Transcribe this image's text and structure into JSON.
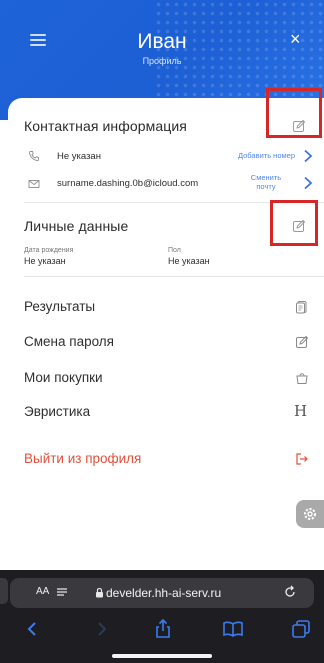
{
  "header": {
    "title": "Иван",
    "subtitle": "Профиль",
    "close_label": "×"
  },
  "contact": {
    "title": "Контактная информация",
    "phone_value": "Не указан",
    "phone_action": "Добавить номер",
    "email_value": "surname.dashing.0b@icloud.com",
    "email_action_line1": "Сменить",
    "email_action_line2": "почту"
  },
  "personal": {
    "title": "Личные данные",
    "birth_label": "Дата рождения",
    "birth_value": "Не указан",
    "gender_label": "Пол",
    "gender_value": "Не указан"
  },
  "menu": {
    "results": "Результаты",
    "change_password": "Смена пароля",
    "purchases": "Мои покупки",
    "heuristics": "Эвристика",
    "heuristics_icon_glyph": "H",
    "logout": "Выйти из профиля"
  },
  "browser": {
    "text_size": "AA",
    "url": "develder.hh-ai-serv.ru"
  },
  "colors": {
    "brand_blue": "#1e63d8",
    "link_blue": "#4f86ea",
    "logout_red": "#e2503c",
    "highlight_red": "#d62727"
  },
  "icons": [
    "menu-icon",
    "close-icon",
    "edit-icon",
    "phone-icon",
    "mail-icon",
    "chevron-right-icon",
    "results-icon",
    "pencil-icon",
    "bag-icon",
    "heuristics-icon",
    "logout-icon",
    "gear-icon",
    "lock-icon",
    "reload-icon",
    "back-icon",
    "forward-icon",
    "share-icon",
    "bookmarks-icon",
    "tabs-icon"
  ]
}
